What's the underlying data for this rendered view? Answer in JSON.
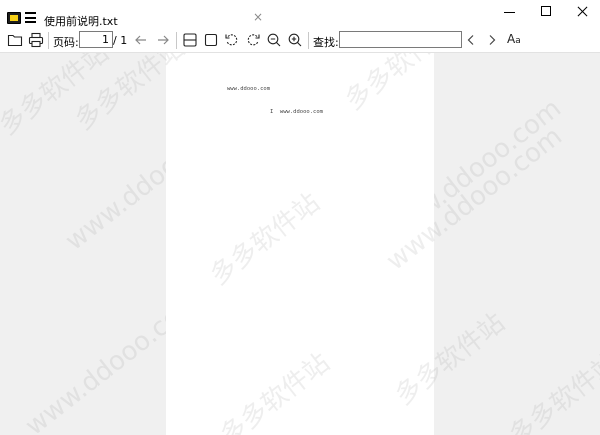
{
  "window": {
    "tab_title": "使用前说明.txt",
    "tab_close": "×"
  },
  "toolbar": {
    "page_label": "页码:",
    "page_current": "1",
    "page_total": "/ 1",
    "search_label": "查找:",
    "search_value": "",
    "font_button": "A",
    "font_button_small": "a"
  },
  "document": {
    "lines": [
      "www.ddooo.com",
      "I  www.ddooo.com"
    ]
  },
  "watermark": {
    "text_site": "www.ddooo.com",
    "text_cn": "多多软件站"
  },
  "colors": {
    "workspace_bg": "#f0f0f0",
    "page_bg": "#ffffff",
    "logo_accent": "#f7d117"
  }
}
